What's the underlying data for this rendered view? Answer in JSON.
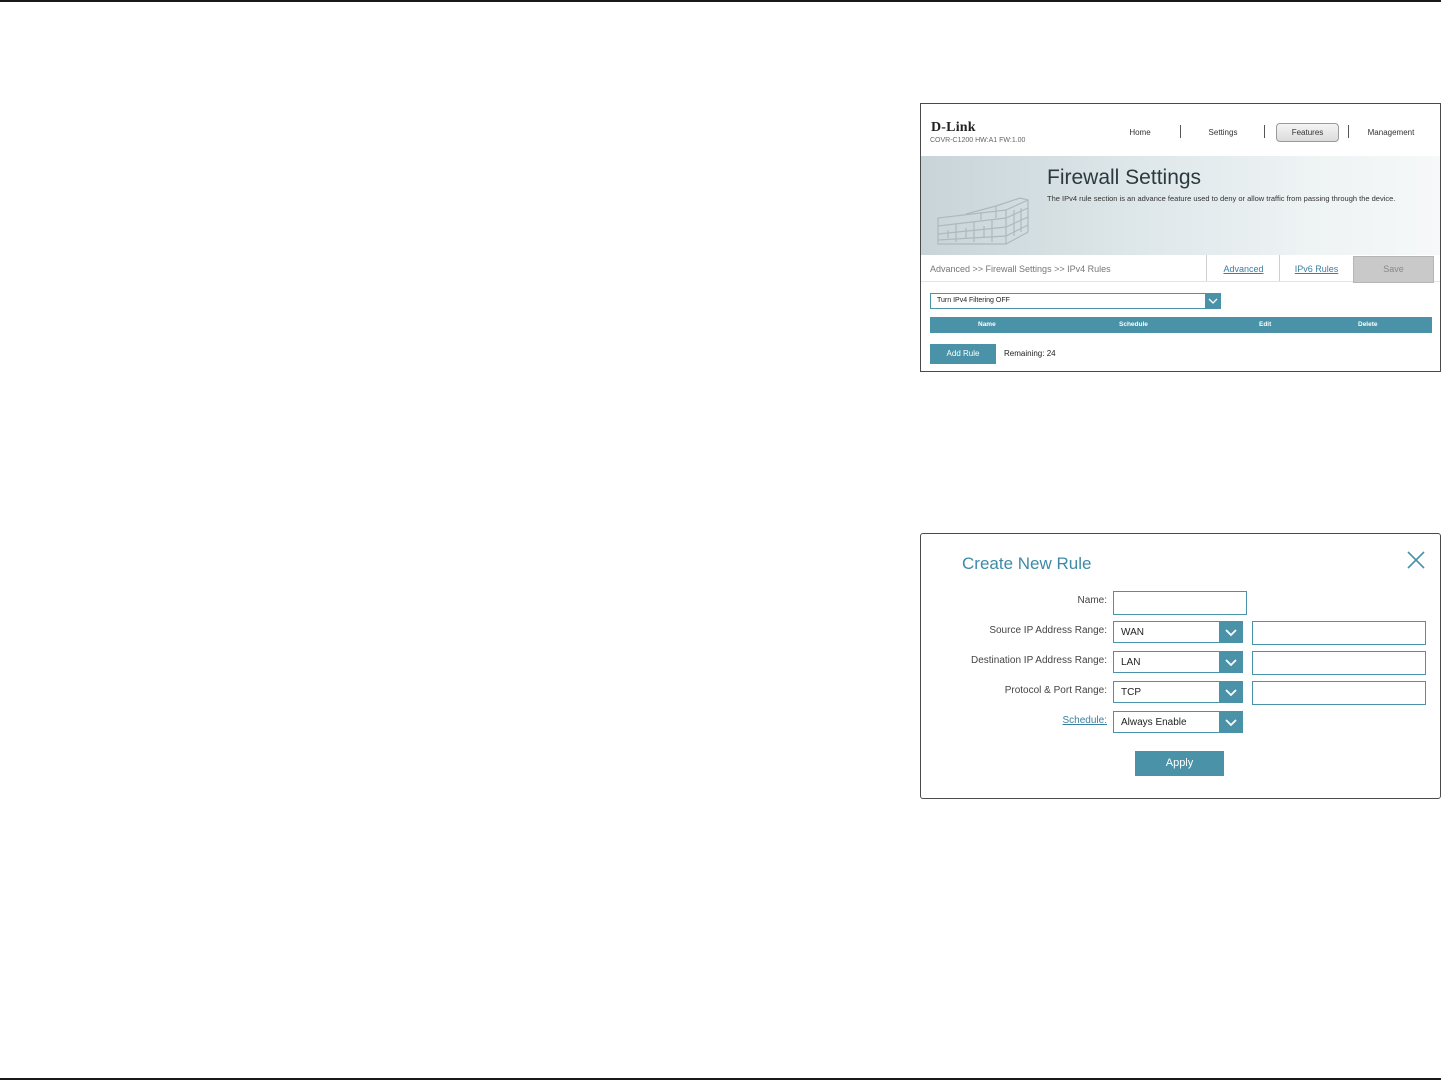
{
  "firewall_page": {
    "logo": "D-Link",
    "model": "COVR-C1200 HW:A1 FW:1.00",
    "nav": {
      "home": "Home",
      "settings": "Settings",
      "features": "Features",
      "management": "Management"
    },
    "title": "Firewall Settings",
    "description": "The IPv4 rule section is an advance feature used to deny or allow traffic from passing through the device.",
    "breadcrumb": "Advanced >> Firewall Settings >> IPv4 Rules",
    "tabs": {
      "advanced": "Advanced",
      "ipv6_rules": "IPv6 Rules"
    },
    "save": "Save",
    "filter_select": "Turn IPv4 Filtering OFF",
    "table_headers": [
      "Name",
      "Schedule",
      "Edit",
      "Delete"
    ],
    "add_rule": "Add Rule",
    "remaining": "Remaining: 24"
  },
  "create_rule": {
    "title": "Create New Rule",
    "fields": {
      "name_label": "Name:",
      "name_value": "",
      "source_label": "Source IP Address Range:",
      "source_select": "WAN",
      "source_range_value": "",
      "destination_label": "Destination IP Address Range:",
      "destination_select": "LAN",
      "destination_range_value": "",
      "protocol_label": "Protocol & Port Range:",
      "protocol_select": "TCP",
      "port_range_value": "",
      "schedule_label": "Schedule:",
      "schedule_select": "Always Enable"
    },
    "apply": "Apply"
  },
  "colors": {
    "accent": "#4a92a8",
    "title_teal": "#3d8ba5",
    "link": "#3a7fa0"
  }
}
